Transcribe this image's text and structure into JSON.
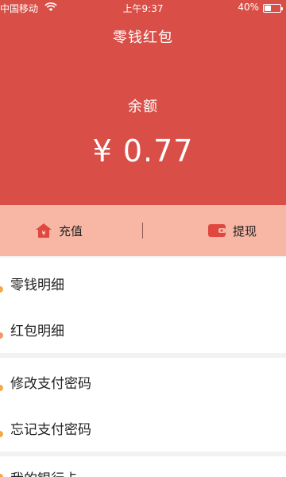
{
  "status_bar": {
    "carrier": "中国移动",
    "time": "上午9:37",
    "battery": "40%",
    "battery_level": 0.4
  },
  "header": {
    "title": "零钱红包",
    "balance_label": "余额",
    "balance_amount": "¥ 0.77",
    "color": "#d94f48"
  },
  "actions": {
    "recharge": "充值",
    "withdraw": "提现",
    "background": "#f8b7a5",
    "icon_color": "#e0473e"
  },
  "groups": [
    {
      "items": [
        {
          "label": "零钱明细",
          "icon": "orange-dot-icon"
        },
        {
          "label": "红包明细",
          "icon": "orange-dot-icon"
        }
      ]
    },
    {
      "items": [
        {
          "label": "修改支付密码",
          "icon": "orange-dot-icon"
        },
        {
          "label": "忘记支付密码",
          "icon": "orange-dot-icon"
        }
      ]
    },
    {
      "items": [
        {
          "label": "我的银行卡",
          "icon": "orange-dot-icon"
        }
      ]
    }
  ]
}
